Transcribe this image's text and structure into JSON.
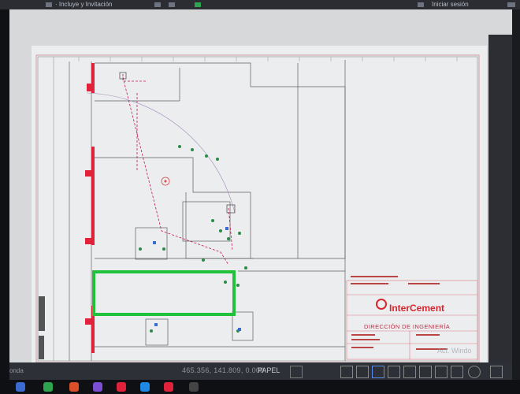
{
  "window": {
    "title_left": "· Incluye y Invitación",
    "title_right": "Iniciar sesión"
  },
  "drawing": {
    "brand": "InterCement",
    "department": "DIRECCIÓN DE INGENIERÍA",
    "layout_tab": "PAPEL"
  },
  "statusbar": {
    "coordinates": "465.356, 141.809, 0.000",
    "space": "PAPEL",
    "command_hint": "onda"
  },
  "watermark": "Act. Windo",
  "colors": {
    "highlight_green": "#1fc23a",
    "wall_red": "#e0233b",
    "brand_red": "#d7262d"
  }
}
